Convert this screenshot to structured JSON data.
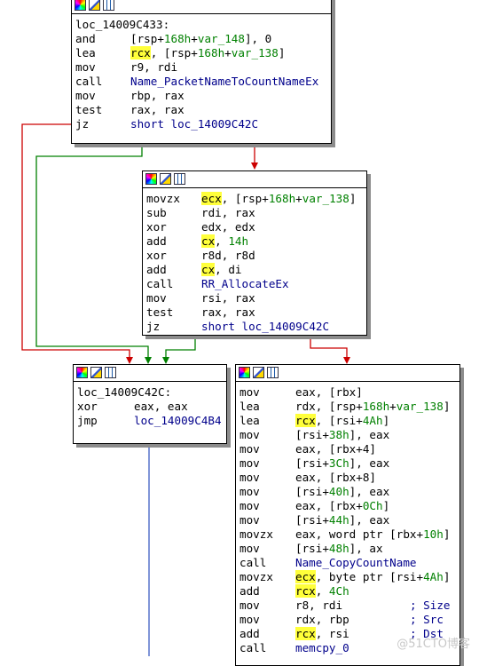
{
  "colors": {
    "edge_true": "#008000",
    "edge_false": "#cc0000",
    "edge_uncond": "#3d5ec4",
    "highlight": "#ffff3a"
  },
  "icons": [
    "color-palette-icon",
    "edit-pencil-icon",
    "graph-view-icon"
  ],
  "blocks": [
    {
      "label": "loc_14009C433:",
      "lines": [
        {
          "mnem": "and",
          "ops": "[rsp+168h+var_148], 0"
        },
        {
          "mnem": "lea",
          "ops": "rcx, [rsp+168h+var_138]"
        },
        {
          "mnem": "mov",
          "ops": "r9, rdi"
        },
        {
          "mnem": "call",
          "ops": "Name_PacketNameToCountNameEx"
        },
        {
          "mnem": "mov",
          "ops": "rbp, rax"
        },
        {
          "mnem": "test",
          "ops": "rax, rax"
        },
        {
          "mnem": "jz",
          "ops": "short loc_14009C42C"
        }
      ]
    },
    {
      "label": "",
      "lines": [
        {
          "mnem": "movzx",
          "ops": "ecx, [rsp+168h+var_138]"
        },
        {
          "mnem": "sub",
          "ops": "rdi, rax"
        },
        {
          "mnem": "xor",
          "ops": "edx, edx"
        },
        {
          "mnem": "add",
          "ops": "cx, 14h"
        },
        {
          "mnem": "xor",
          "ops": "r8d, r8d"
        },
        {
          "mnem": "add",
          "ops": "cx, di"
        },
        {
          "mnem": "call",
          "ops": "RR_AllocateEx"
        },
        {
          "mnem": "mov",
          "ops": "rsi, rax"
        },
        {
          "mnem": "test",
          "ops": "rax, rax"
        },
        {
          "mnem": "jz",
          "ops": "short loc_14009C42C"
        }
      ]
    },
    {
      "label": "loc_14009C42C:",
      "lines": [
        {
          "mnem": "xor",
          "ops": "eax, eax"
        },
        {
          "mnem": "jmp",
          "ops": "loc_14009C4B4"
        }
      ]
    },
    {
      "label": "",
      "lines": [
        {
          "mnem": "mov",
          "ops": "eax, [rbx]"
        },
        {
          "mnem": "lea",
          "ops": "rdx, [rsp+168h+var_138]"
        },
        {
          "mnem": "lea",
          "ops": "rcx, [rsi+4Ah]"
        },
        {
          "mnem": "mov",
          "ops": "[rsi+38h], eax"
        },
        {
          "mnem": "mov",
          "ops": "eax, [rbx+4]"
        },
        {
          "mnem": "mov",
          "ops": "[rsi+3Ch], eax"
        },
        {
          "mnem": "mov",
          "ops": "eax, [rbx+8]"
        },
        {
          "mnem": "mov",
          "ops": "[rsi+40h], eax"
        },
        {
          "mnem": "mov",
          "ops": "eax, [rbx+0Ch]"
        },
        {
          "mnem": "mov",
          "ops": "[rsi+44h], eax"
        },
        {
          "mnem": "movzx",
          "ops": "eax, word ptr [rbx+10h]"
        },
        {
          "mnem": "mov",
          "ops": "[rsi+48h], ax"
        },
        {
          "mnem": "call",
          "ops": "Name_CopyCountName"
        },
        {
          "mnem": "movzx",
          "ops": "ecx, byte ptr [rsi+4Ah]"
        },
        {
          "mnem": "add",
          "ops": "rcx, 4Ch"
        },
        {
          "mnem": "mov",
          "ops": "r8, rdi",
          "comment": "; Size"
        },
        {
          "mnem": "mov",
          "ops": "rdx, rbp",
          "comment": "; Src"
        },
        {
          "mnem": "add",
          "ops": "rcx, rsi",
          "comment": "; Dst"
        },
        {
          "mnem": "call",
          "ops": "memcpy_0"
        }
      ]
    }
  ],
  "watermark": "@51CTO博客"
}
